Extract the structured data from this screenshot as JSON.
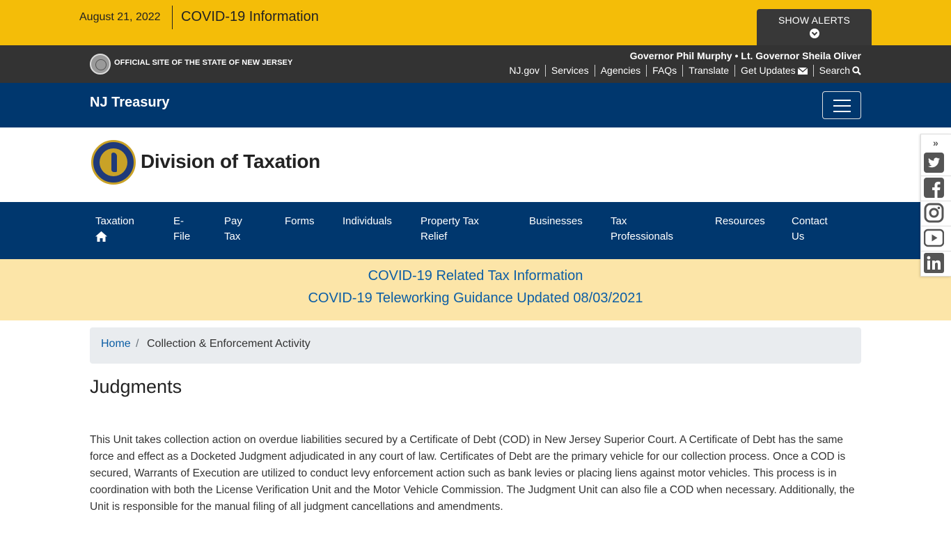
{
  "alert_bar": {
    "date": "August 21, 2022",
    "title": "COVID-19 Information",
    "show_alerts_label": "SHOW ALERTS",
    "bg_color": "#f4bd08"
  },
  "state_bar": {
    "official_label": "OFFICIAL SITE OF THE STATE OF NEW JERSEY",
    "governor_line": "Governor Phil Murphy • Lt. Governor Sheila Oliver",
    "links": [
      "NJ.gov",
      "Services",
      "Agencies",
      "FAQs",
      "Translate",
      "Get Updates",
      "Search"
    ]
  },
  "treasury": {
    "title": "NJ Treasury",
    "bg_color": "#00376e"
  },
  "division": {
    "title": "Division of Taxation"
  },
  "nav": {
    "items": [
      {
        "line1": "Taxation",
        "line2": ""
      },
      {
        "line1": "E-",
        "line2": "File"
      },
      {
        "line1": "Pay",
        "line2": "Tax"
      },
      {
        "line1": "Forms",
        "line2": ""
      },
      {
        "line1": "Individuals",
        "line2": ""
      },
      {
        "line1": "Property Tax",
        "line2": "Relief"
      },
      {
        "line1": "Businesses",
        "line2": ""
      },
      {
        "line1": "Tax",
        "line2": "Professionals"
      },
      {
        "line1": "Resources",
        "line2": ""
      },
      {
        "line1": "Contact",
        "line2": "Us"
      }
    ]
  },
  "covid_banner": {
    "line1": "COVID-19 Related Tax Information",
    "line2": "COVID-19 Teleworking Guidance Updated 08/03/2021",
    "link_color": "#0c5ea5",
    "bg_color": "#fce5a8"
  },
  "social_icons": [
    "twitter-icon",
    "facebook-icon",
    "instagram-icon",
    "youtube-icon",
    "linkedin-icon"
  ],
  "breadcrumb": {
    "home": "Home",
    "separator": "/",
    "current": "Collection & Enforcement Activity"
  },
  "page": {
    "title": "Judgments",
    "body": "This Unit takes collection action on overdue liabilities secured by a Certificate of Debt (COD) in New Jersey Superior Court. A Certificate of Debt has the same force and effect as a Docketed Judgment adjudicated in any court of law. Certificates of Debt are the primary vehicle for our collection process. Once a COD is secured, Warrants of Execution are utilized to conduct levy enforcement action such as bank levies or placing liens against motor vehicles. This process is in coordination with both the License Verification Unit and the Motor Vehicle Commission. The Judgment Unit can also file a COD when necessary. Additionally, the Unit is responsible for the manual filing of all judgment cancellations and amendments."
  }
}
